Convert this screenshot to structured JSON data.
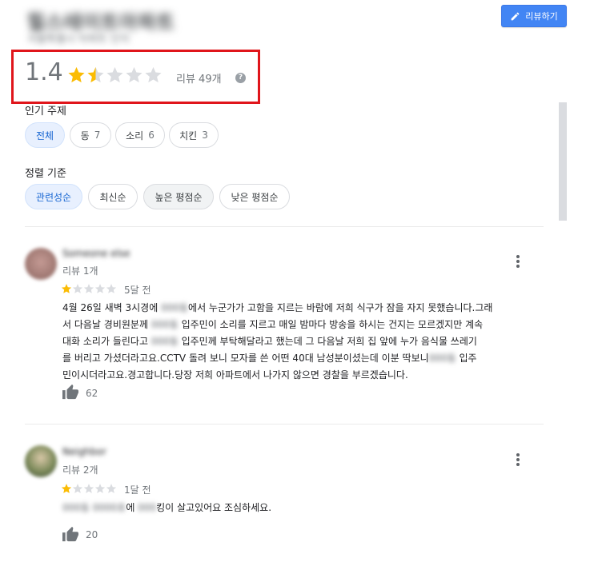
{
  "header": {
    "place_title": "힐스테이트아파트",
    "place_subtitle": "서울특별시 아파트 단지",
    "write_review_label": "리뷰하기"
  },
  "summary": {
    "rating": "1.4",
    "stars": 1.4,
    "review_count": "리뷰 49개",
    "star_color": "#fbbc04"
  },
  "topics": {
    "label": "인기 주제",
    "chips": [
      {
        "label": "전체",
        "count": ""
      },
      {
        "label": "동",
        "count": "7"
      },
      {
        "label": "소리",
        "count": "6"
      },
      {
        "label": "치킨",
        "count": "3"
      }
    ]
  },
  "sort": {
    "label": "정렬 기준",
    "chips": [
      {
        "label": "관련성순"
      },
      {
        "label": "최신순"
      },
      {
        "label": "높은 평점순"
      },
      {
        "label": "낮은 평점순"
      }
    ]
  },
  "reviews": [
    {
      "name": "Someone else",
      "count": "리뷰 1개",
      "stars": 1,
      "date": "5달 전",
      "lines": [
        {
          "a": "4월 26일 새벽 3시경에 ",
          "blur": "000동",
          "b": "에서 누군가가 고함을 지르는 바람에 저희 식구가 잠을 자지 못했습니다.그래"
        },
        {
          "a": "서 다음날 경비원분께 ",
          "blur": "000동",
          "b": " 입주민이 소리를 지르고 매일 밤마다 방송을 하시는 건지는 모르겠지만 계속"
        },
        {
          "a": "대화 소리가 들린다고 ",
          "blur": "000동",
          "b": " 입주민께 부탁해달라고 했는데 그 다음날 저희 집 앞에 누가 음식물 쓰레기"
        },
        {
          "a": "를 버리고 가셨더라고요.CCTV 돌려 보니 모자를 쓴 어떤 40대 남성분이셨는데 이분 딱보니",
          "blur": "000동",
          "b": " 입주"
        },
        {
          "a": "민이시더라고요.경고합니다.당장 저희 아파트에서 나가지 않으면 경찰을 부르겠습니다.",
          "blur": "",
          "b": ""
        }
      ],
      "likes": "62"
    },
    {
      "name": "Neighbor",
      "count": "리뷰 2개",
      "stars": 1,
      "date": "1달 전",
      "lines": [
        {
          "a": "",
          "blur": "000동 0000호",
          "b": "에 "
        },
        {
          "a": "",
          "blur": "000",
          "b": "킹이 살고있어요 조심하세요."
        }
      ],
      "likes": "20"
    }
  ]
}
